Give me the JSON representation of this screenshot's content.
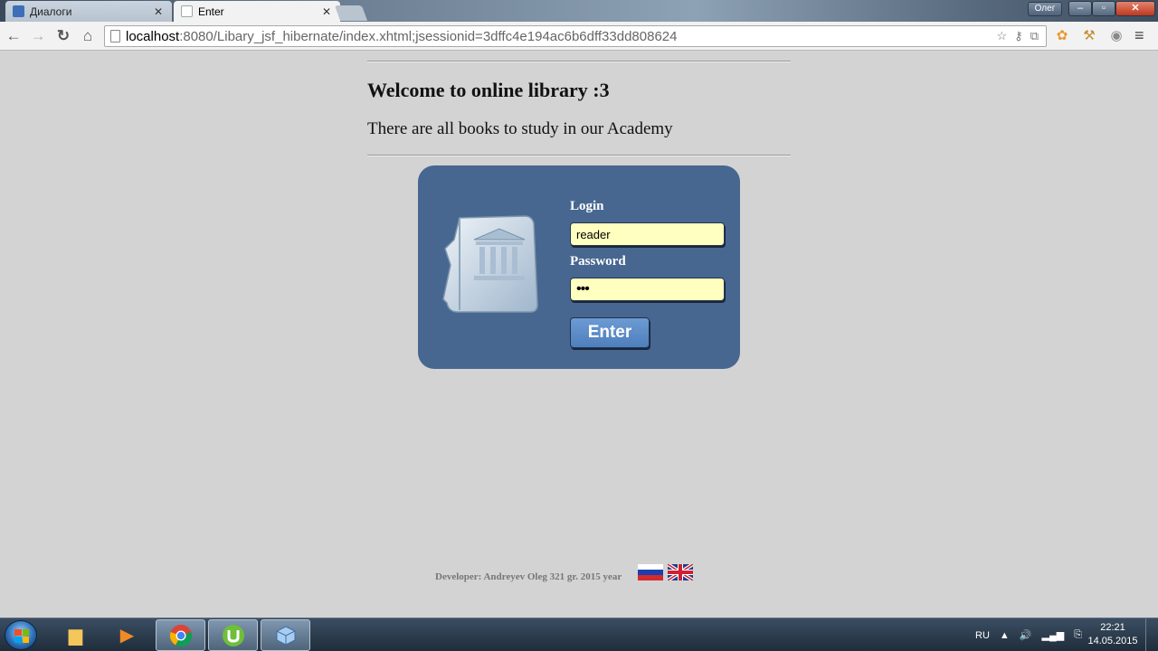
{
  "browser": {
    "tabs": [
      {
        "label": "Диалоги",
        "active": false
      },
      {
        "label": "Enter",
        "active": true
      }
    ],
    "user_badge": "Олег",
    "address": {
      "host": "localhost",
      "rest": ":8080/Libary_jsf_hibernate/index.xhtml;jsessionid=3dffc4e194ac6b6dff33dd808624"
    }
  },
  "page": {
    "welcome_title": "Welcome to online library :3",
    "subtitle": "There are all books to study in our Academy",
    "login_form": {
      "login_label": "Login",
      "login_value": "reader",
      "password_label": "Password",
      "password_value": "•••",
      "enter_label": "Enter"
    },
    "footer": "Developer: Andreyev Oleg 321 gr. 2015 year",
    "languages": [
      "ru",
      "en"
    ]
  },
  "taskbar": {
    "apps": [
      "explorer",
      "media-player",
      "chrome",
      "utorrent",
      "virtualbox"
    ],
    "tray": {
      "language": "RU",
      "time": "22:21",
      "date": "14.05.2015"
    }
  },
  "colors": {
    "page_bg": "#d3d3d3",
    "panel_bg": "#476790",
    "input_bg": "#ffffc0",
    "button_bg": "#5b8bc8"
  }
}
